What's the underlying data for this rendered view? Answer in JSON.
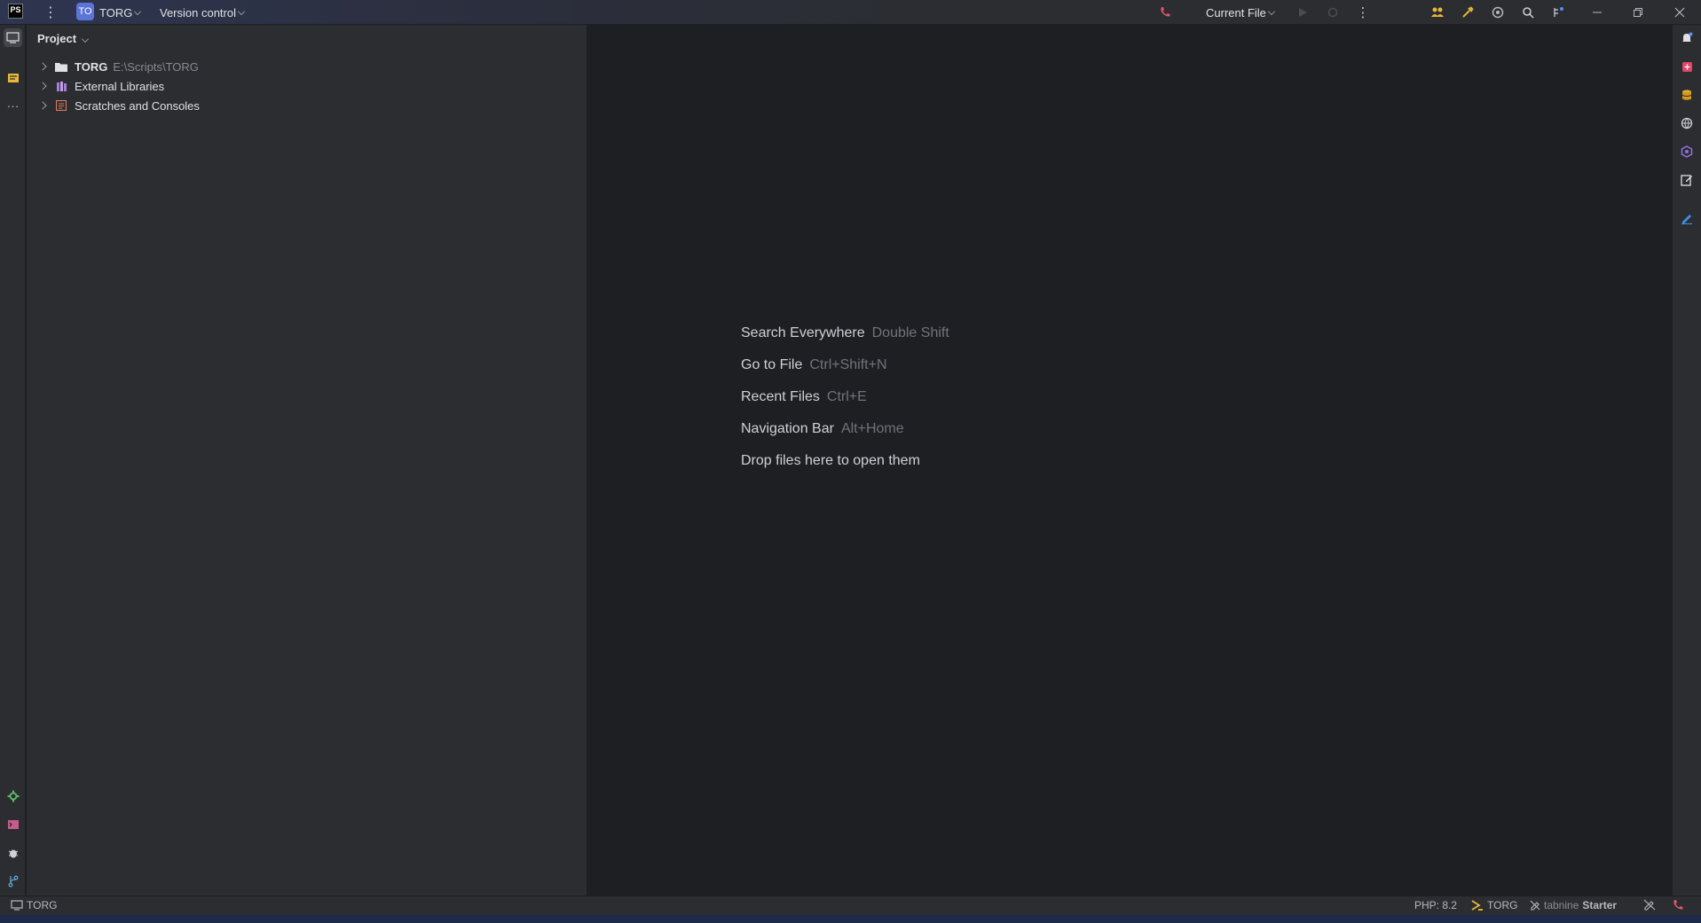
{
  "titlebar": {
    "app_badge": "PS",
    "project_badge": "TO",
    "project_name": "TORG",
    "vcs_label": "Version control",
    "run_config": "Current File"
  },
  "project_panel": {
    "title": "Project",
    "tree": [
      {
        "label": "TORG",
        "path": "E:\\Scripts\\TORG",
        "icon": "folder-icon"
      },
      {
        "label": "External Libraries",
        "path": "",
        "icon": "library-icon"
      },
      {
        "label": "Scratches and Consoles",
        "path": "",
        "icon": "scratches-icon"
      }
    ]
  },
  "editor": {
    "hints": [
      {
        "label": "Search Everywhere",
        "shortcut": "Double Shift"
      },
      {
        "label": "Go to File",
        "shortcut": "Ctrl+Shift+N"
      },
      {
        "label": "Recent Files",
        "shortcut": "Ctrl+E"
      },
      {
        "label": "Navigation Bar",
        "shortcut": "Alt+Home"
      },
      {
        "label": "Drop files here to open them",
        "shortcut": ""
      }
    ]
  },
  "statusbar": {
    "project": "TORG",
    "php_version": "PHP: 8.2",
    "interpreter": "TORG",
    "tabnine_brand": "tabnine",
    "tabnine_plan": "Starter"
  },
  "colors": {
    "accent": "#5a74d8",
    "panel_bg": "#2b2d30",
    "editor_bg": "#1e1f22"
  }
}
